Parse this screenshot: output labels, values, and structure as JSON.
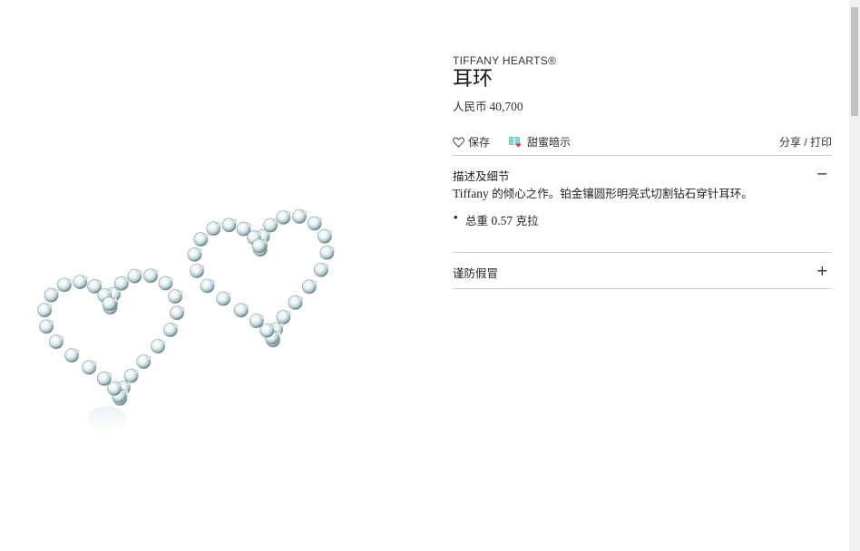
{
  "product": {
    "collection": "TIFFANY HEARTS®",
    "title": "耳环",
    "price_label": "人民币",
    "price_value": "40,700",
    "image_alt_icon": "heart-earrings-image"
  },
  "actions": {
    "save_label": "保存",
    "hint_label": "甜蜜暗示",
    "share_label": "分享 / 打印"
  },
  "accordion": [
    {
      "title": "描述及细节",
      "toggle": "−",
      "expanded": true,
      "description_brand": "Tiffany",
      "description_text": " 的倾心之作。铂金镶圆形明亮式切割钻石穿针耳环。",
      "specs": [
        {
          "label": "总重",
          "value": "0.57",
          "unit": "克拉"
        }
      ]
    },
    {
      "title": "谨防假冒",
      "toggle": "+",
      "expanded": false
    }
  ],
  "colors": {
    "text": "#222222",
    "divider": "#cfcfcf",
    "gift_box": "#81d8d0",
    "gift_heart": "#e0324b"
  }
}
